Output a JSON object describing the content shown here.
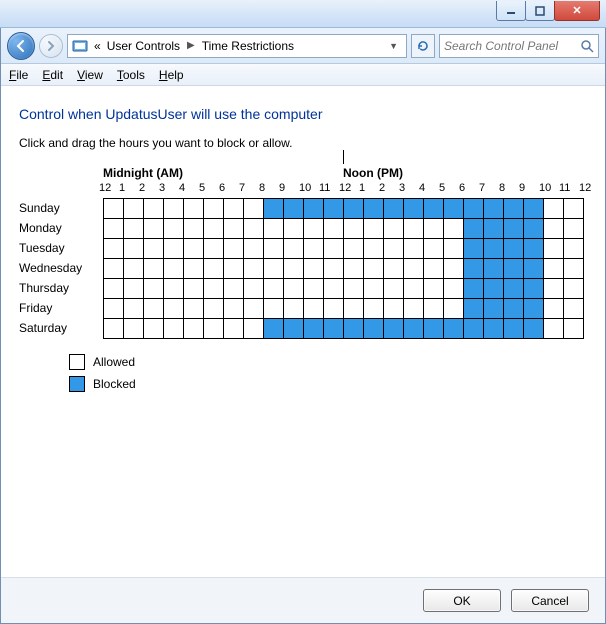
{
  "window": {
    "minimize_tip": "Minimize",
    "maximize_tip": "Maximize",
    "close_tip": "Close"
  },
  "nav": {
    "back_tip": "Back",
    "forward_tip": "Forward",
    "refresh_tip": "Refresh",
    "lead": "«",
    "crumb1": "User Controls",
    "crumb2": "Time Restrictions",
    "search_placeholder": "Search Control Panel"
  },
  "menu": {
    "file": "File",
    "edit": "Edit",
    "view": "View",
    "tools": "Tools",
    "help": "Help"
  },
  "page": {
    "title": "Control when UpdatusUser will use the computer",
    "instruction": "Click and drag the hours you want to block or allow.",
    "am_label": "Midnight (AM)",
    "pm_label": "Noon (PM)",
    "hours": [
      "12",
      "1",
      "2",
      "3",
      "4",
      "5",
      "6",
      "7",
      "8",
      "9",
      "10",
      "11",
      "12",
      "1",
      "2",
      "3",
      "4",
      "5",
      "6",
      "7",
      "8",
      "9",
      "10",
      "11",
      "12"
    ],
    "days": [
      "Sunday",
      "Monday",
      "Tuesday",
      "Wednesday",
      "Thursday",
      "Friday",
      "Saturday"
    ],
    "schedule": [
      [
        0,
        0,
        0,
        0,
        0,
        0,
        0,
        0,
        1,
        1,
        1,
        1,
        1,
        1,
        1,
        1,
        1,
        1,
        1,
        1,
        1,
        1,
        0,
        0
      ],
      [
        0,
        0,
        0,
        0,
        0,
        0,
        0,
        0,
        0,
        0,
        0,
        0,
        0,
        0,
        0,
        0,
        0,
        0,
        1,
        1,
        1,
        1,
        0,
        0
      ],
      [
        0,
        0,
        0,
        0,
        0,
        0,
        0,
        0,
        0,
        0,
        0,
        0,
        0,
        0,
        0,
        0,
        0,
        0,
        1,
        1,
        1,
        1,
        0,
        0
      ],
      [
        0,
        0,
        0,
        0,
        0,
        0,
        0,
        0,
        0,
        0,
        0,
        0,
        0,
        0,
        0,
        0,
        0,
        0,
        1,
        1,
        1,
        1,
        0,
        0
      ],
      [
        0,
        0,
        0,
        0,
        0,
        0,
        0,
        0,
        0,
        0,
        0,
        0,
        0,
        0,
        0,
        0,
        0,
        0,
        1,
        1,
        1,
        1,
        0,
        0
      ],
      [
        0,
        0,
        0,
        0,
        0,
        0,
        0,
        0,
        0,
        0,
        0,
        0,
        0,
        0,
        0,
        0,
        0,
        0,
        1,
        1,
        1,
        1,
        0,
        0
      ],
      [
        0,
        0,
        0,
        0,
        0,
        0,
        0,
        0,
        1,
        1,
        1,
        1,
        1,
        1,
        1,
        1,
        1,
        1,
        1,
        1,
        1,
        1,
        0,
        0
      ]
    ],
    "legend_allowed": "Allowed",
    "legend_blocked": "Blocked"
  },
  "buttons": {
    "ok": "OK",
    "cancel": "Cancel"
  }
}
